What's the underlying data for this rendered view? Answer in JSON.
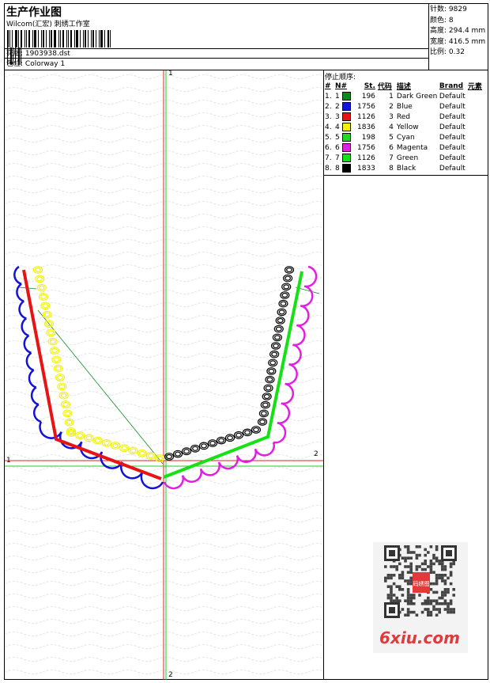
{
  "header": {
    "title": "生产作业图",
    "company": "Wilcom(汇宏) 刺绣工作室",
    "design_label": "花版:",
    "design_value": "1903938.dst",
    "colorway_label": "色位:",
    "colorway_value": "Colorway 1"
  },
  "stats": [
    {
      "label": "针数:",
      "value": "9829"
    },
    {
      "label": "颜色:",
      "value": "8"
    },
    {
      "label": "高度:",
      "value": "294.4 mm"
    },
    {
      "label": "宽度:",
      "value": "416.5 mm"
    },
    {
      "label": "比例:",
      "value": "0.32"
    }
  ],
  "stop_panel": {
    "caption": "停止顺序:",
    "columns": [
      "#",
      "N#",
      "St.",
      "代码",
      "描述",
      "Brand",
      "元素"
    ],
    "rows": [
      {
        "idx": "1.",
        "n": "1",
        "color": "#0c8a1e",
        "st": "196",
        "code": "1",
        "desc": "Dark Green",
        "brand": "Default"
      },
      {
        "idx": "2.",
        "n": "2",
        "color": "#1212d8",
        "st": "1756",
        "code": "2",
        "desc": "Blue",
        "brand": "Default"
      },
      {
        "idx": "3.",
        "n": "3",
        "color": "#e81414",
        "st": "1126",
        "code": "3",
        "desc": "Red",
        "brand": "Default"
      },
      {
        "idx": "4.",
        "n": "4",
        "color": "#f2f20e",
        "st": "1836",
        "code": "4",
        "desc": "Yellow",
        "brand": "Default"
      },
      {
        "idx": "5.",
        "n": "5",
        "color": "#22d822",
        "st": "198",
        "code": "5",
        "desc": "Cyan",
        "brand": "Default"
      },
      {
        "idx": "6.",
        "n": "6",
        "color": "#e21ee2",
        "st": "1756",
        "code": "6",
        "desc": "Magenta",
        "brand": "Default"
      },
      {
        "idx": "7.",
        "n": "7",
        "color": "#16e016",
        "st": "1126",
        "code": "7",
        "desc": "Green",
        "brand": "Default"
      },
      {
        "idx": "8.",
        "n": "8",
        "color": "#000000",
        "st": "1833",
        "code": "8",
        "desc": "Black",
        "brand": "Default"
      }
    ]
  },
  "axes": {
    "top": "1",
    "bottom": "2",
    "left": "1",
    "right": "2"
  },
  "watermark": {
    "text": "6xiu.com",
    "qr_text": "码绣图"
  }
}
